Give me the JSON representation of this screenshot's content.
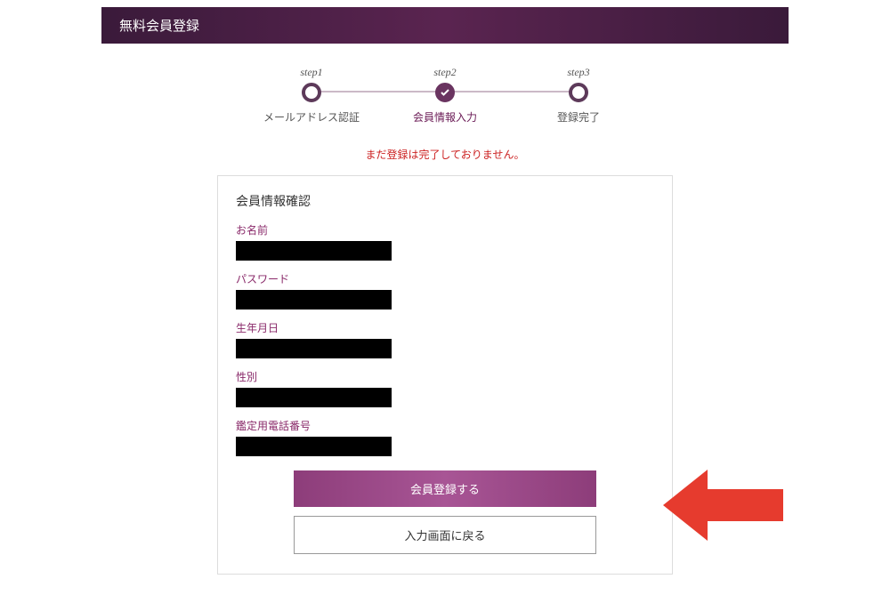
{
  "header": {
    "title": "無料会員登録"
  },
  "steps": {
    "items": [
      {
        "top": "step1",
        "bottom": "メールアドレス認証"
      },
      {
        "top": "step2",
        "bottom": "会員情報入力"
      },
      {
        "top": "step3",
        "bottom": "登録完了"
      }
    ]
  },
  "warning": "まだ登録は完了しておりません。",
  "form": {
    "title": "会員情報確認",
    "fields": {
      "name_label": "お名前",
      "password_label": "パスワード",
      "birthdate_label": "生年月日",
      "gender_label": "性別",
      "phone_label": "鑑定用電話番号"
    },
    "buttons": {
      "submit": "会員登録する",
      "back": "入力画面に戻る"
    }
  }
}
